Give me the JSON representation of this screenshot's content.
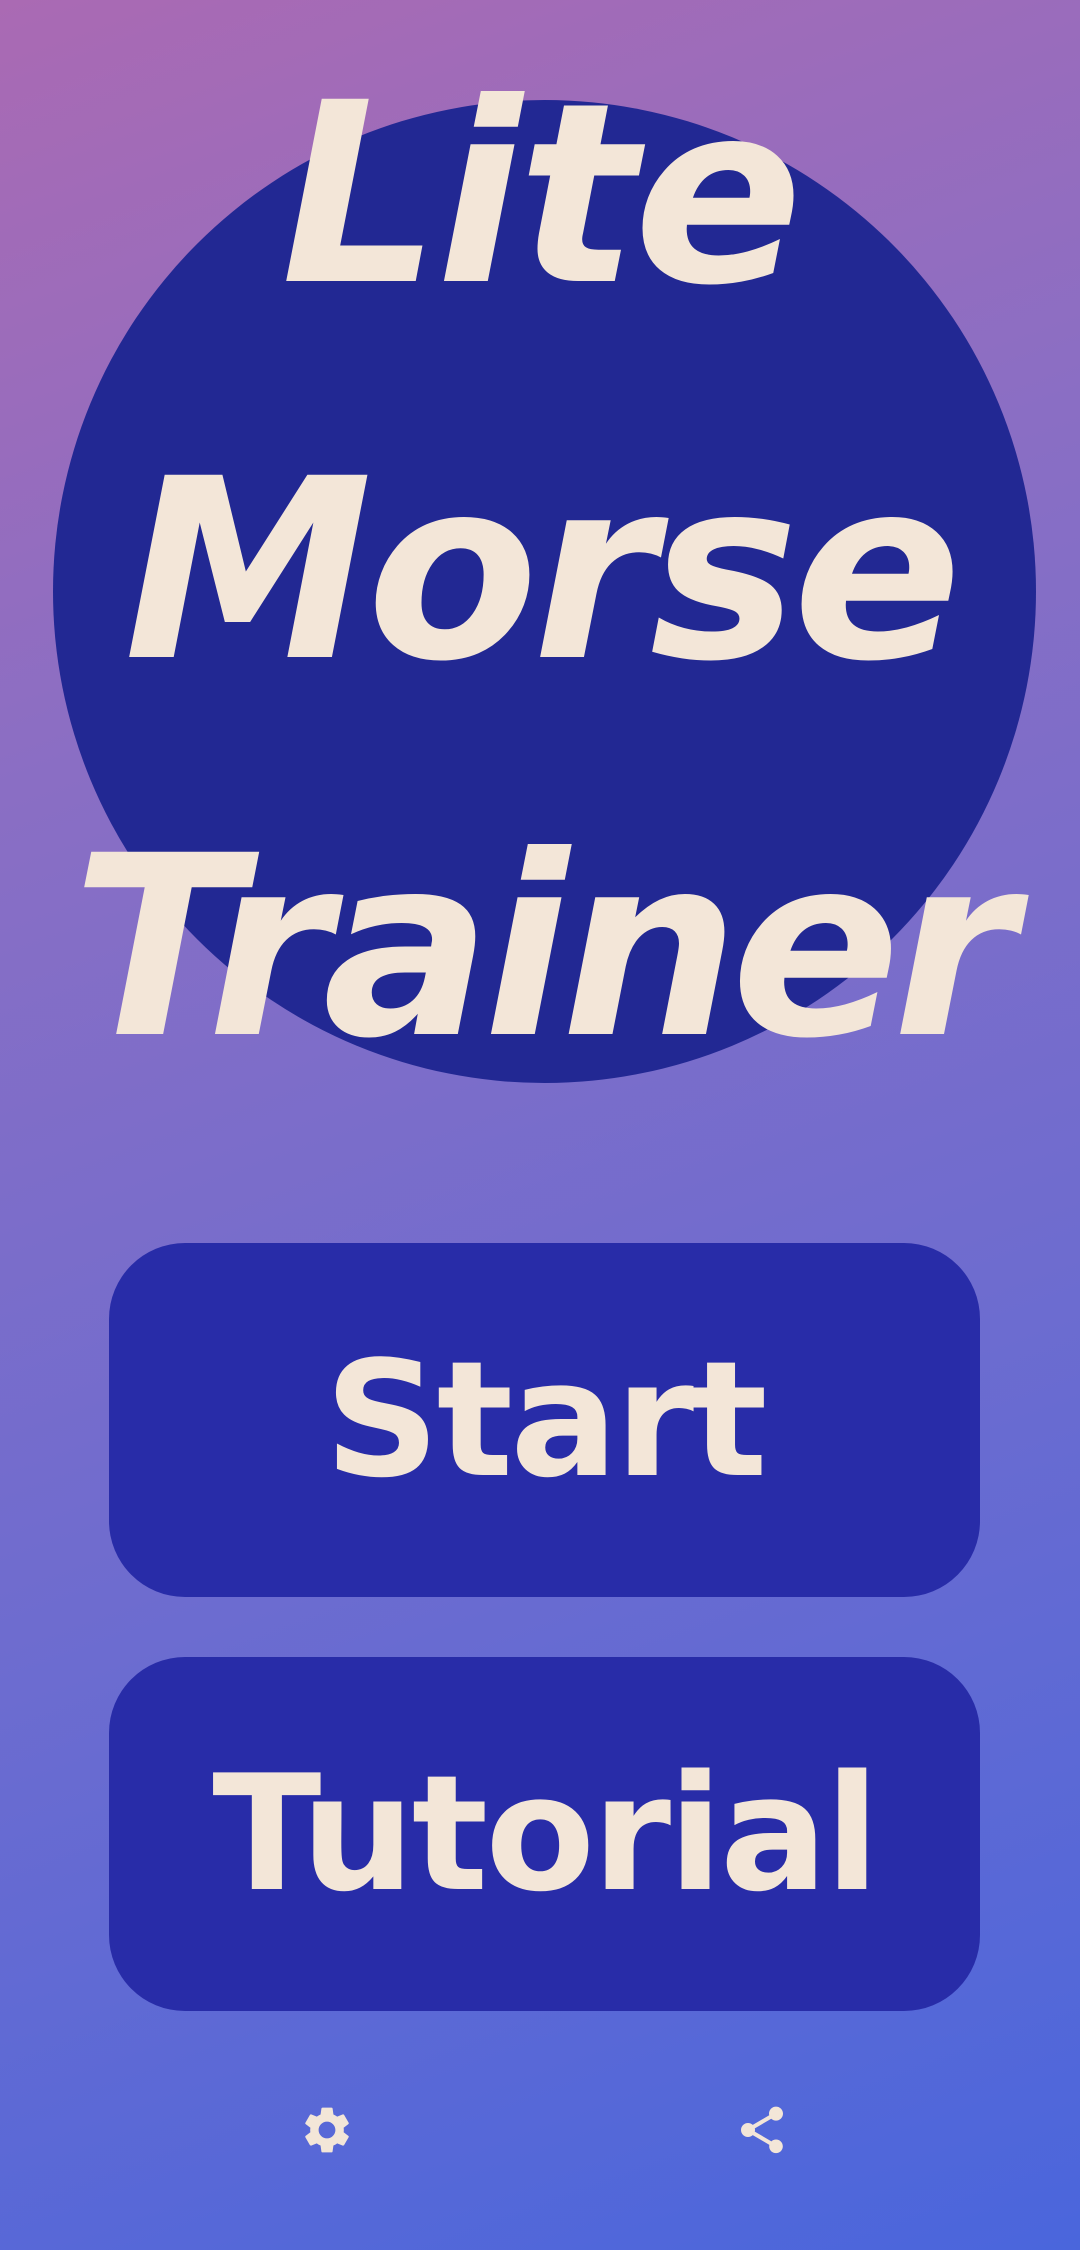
{
  "app": {
    "title_lines": [
      "Lite",
      "Morse",
      "Trainer"
    ]
  },
  "menu": {
    "start_label": "Start",
    "tutorial_label": "Tutorial"
  },
  "footer": {
    "settings_icon": "gear-icon",
    "share_icon": "share-icon"
  },
  "colors": {
    "background_top": "#aa6ab3",
    "background_bottom": "#4a66dc",
    "circle": "#222893",
    "button": "#282ca8",
    "text": "#f3e6d8"
  }
}
